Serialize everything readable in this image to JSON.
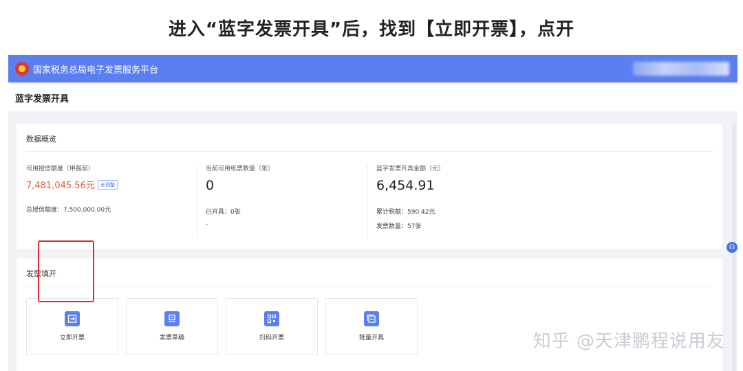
{
  "caption": "进入“蓝字发票开具”后，找到【立即开票】，点开",
  "topbar": {
    "title": "国家税务总局电子发票服务平台"
  },
  "page": {
    "title": "蓝字发票开具"
  },
  "overview": {
    "title": "数据概览",
    "stats": [
      {
        "label": "可用授信额度（申报前）",
        "value": "7,481,045.56元",
        "action": "去调整",
        "sub": [
          "总授信额度：7,500,000.00元"
        ]
      },
      {
        "label": "当前可用纸票数量（张）",
        "value": "0",
        "sub": [
          "已开具：0张",
          "-"
        ]
      },
      {
        "label": "蓝字发票开具金额（元）",
        "value": "6,454.91",
        "sub": [
          "累计税额：590.42元",
          "发票数量：57张"
        ]
      }
    ]
  },
  "fill": {
    "title": "发票填开",
    "tiles": [
      {
        "label": "立即开票",
        "icon": "issue-now-icon"
      },
      {
        "label": "发票草稿",
        "icon": "draft-icon"
      },
      {
        "label": "扫码开票",
        "icon": "qr-code-icon"
      },
      {
        "label": "批量开具",
        "icon": "batch-icon"
      }
    ]
  },
  "watermark": "知乎 @天津鹏程说用友",
  "colors": {
    "brand": "#5b7ff0",
    "highlight": "#e32b2b",
    "amount": "#e35b36"
  }
}
